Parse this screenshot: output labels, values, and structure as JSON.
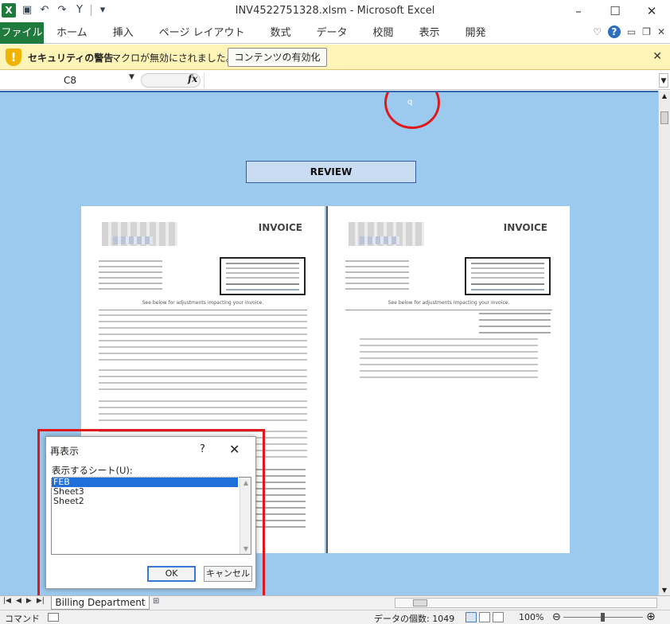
{
  "window": {
    "title": "INV4522751328.xlsm - Microsoft Excel",
    "app_logo": "X",
    "controls": {
      "help": "?",
      "minimize": "–",
      "maximize": "☐",
      "close": "✕"
    }
  },
  "ribbon": {
    "file_tab": "ファイル",
    "tabs": [
      "ホーム",
      "挿入",
      "ページ レイアウト",
      "数式",
      "データ",
      "校閲",
      "表示",
      "開発"
    ]
  },
  "security_bar": {
    "title": "セキュリティの警告",
    "message": "マクロが無効にされました。",
    "button": "コンテンツの有効化",
    "close": "✕"
  },
  "formula_bar": {
    "name_box": "C8",
    "fx_label": "fx",
    "formula": ""
  },
  "sheet": {
    "annotation_text": "q",
    "review_button": "REVIEW",
    "invoice_left": {
      "title": "INVOICE",
      "adjustments_note": "See below for adjustments impacting your invoice."
    },
    "invoice_right": {
      "title": "INVOICE",
      "adjustments_note": "See below for adjustments impacting your invoice."
    }
  },
  "unhide_dialog": {
    "title": "再表示",
    "help": "?",
    "close": "✕",
    "label": "表示するシート(U):",
    "sheets": [
      "FEB",
      "Sheet3",
      "Sheet2"
    ],
    "selected_index": 0,
    "ok": "OK",
    "cancel": "キャンセル"
  },
  "sheet_tabs": {
    "active": "Billing Department"
  },
  "status_bar": {
    "mode": "コマンド",
    "count": "データの個数: 1049",
    "zoom": "100%"
  },
  "colors": {
    "excel_green": "#1f7a3d",
    "security_yellow": "#fff4b8",
    "sheet_background": "#9cc9ee",
    "highlight_red": "#e0181b",
    "selection_blue": "#1e6fd9"
  }
}
